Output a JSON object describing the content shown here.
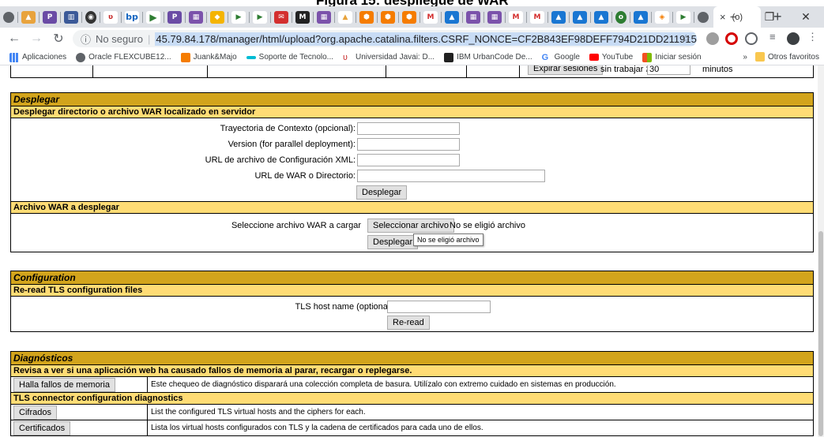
{
  "caption": "Figura 15: despliegue de WAR",
  "colors": {
    "title_bar": "#d2a41c",
    "sub_bar": "#ffdc75",
    "url_highlight": "#c8dcf5"
  },
  "browser": {
    "tab_close": "×",
    "new_tab": "+",
    "window_controls": [
      "−",
      "❐",
      "✕"
    ],
    "security_label": "No seguro",
    "url": "45.79.84.178/manager/html/upload?org.apache.catalina.filters.CSRF_NONCE=CF2B843EF98DEFF794D21DD211915836",
    "bookmarks": [
      {
        "label": "Aplicaciones",
        "icon": "apps-grid-icon",
        "color": "#4285f4"
      },
      {
        "label": "Oracle FLEXCUBE12...",
        "icon": "globe-icon",
        "color": "#5f6368"
      },
      {
        "label": "Juank&Majo",
        "icon": "bookmark-icon",
        "color": "#f57c00"
      },
      {
        "label": "Soporte de Tecnolo...",
        "icon": "bookmark-icon",
        "color": "#00bcd4"
      },
      {
        "label": "Universidad Javai: D...",
        "icon": "bookmark-icon",
        "color": "#c62828"
      },
      {
        "label": "IBM UrbanCode De...",
        "icon": "bookmark-icon",
        "color": "#212121"
      },
      {
        "label": "Google",
        "icon": "google-icon",
        "color": "#4285f4"
      },
      {
        "label": "YouTube",
        "icon": "youtube-icon",
        "color": "#ff0000"
      },
      {
        "label": "Iniciar sesión",
        "icon": "microsoft-icon",
        "color": "#f25022"
      }
    ],
    "bookmarks_more": "»",
    "other_favorites": "Otros favoritos"
  },
  "top_partial": {
    "expire_button": "Expirar sesiones",
    "without_working": "sin trabajar ≥",
    "minutes_value": "30",
    "minutes_label": "minutos"
  },
  "deploy": {
    "title": "Desplegar",
    "dir_section": "Desplegar directorio o archivo WAR localizado en servidor",
    "context_path_label": "Trayectoria de Contexto (opcional):",
    "version_label": "Version (for parallel deployment):",
    "config_url_label": "URL de archivo de Configuración XML:",
    "war_url_label": "URL de WAR o Directorio:",
    "deploy_button": "Desplegar",
    "war_section": "Archivo WAR a desplegar",
    "select_war_label": "Seleccione archivo WAR a cargar",
    "select_file_button": "Seleccionar archivo",
    "no_file_chosen": "No se eligió archivo",
    "upload_button": "Desplegar",
    "tooltip": "No se eligió archivo"
  },
  "configuration": {
    "title": "Configuration",
    "reread_section": "Re-read TLS configuration files",
    "host_label": "TLS host name (optional)",
    "reread_button": "Re-read"
  },
  "diagnostics": {
    "title": "Diagnósticos",
    "leak_section": "Revisa a ver si una aplicación web ha causado fallos de memoria al parar, recargar o replegarse.",
    "leak_button": "Halla fallos de memoria",
    "leak_desc": "Este chequeo de diagnóstico disparará una colección completa de basura. Utilízalo con extremo cuidado en sistemas en producción.",
    "tls_section": "TLS connector configuration diagnostics",
    "ciphers_button": "Cifrados",
    "ciphers_desc": "List the configured TLS virtual hosts and the ciphers for each.",
    "certs_button": "Certificados",
    "certs_desc": "Lista los virtual hosts configurados con TLS y la cadena de certificados para cada uno de ellos."
  }
}
